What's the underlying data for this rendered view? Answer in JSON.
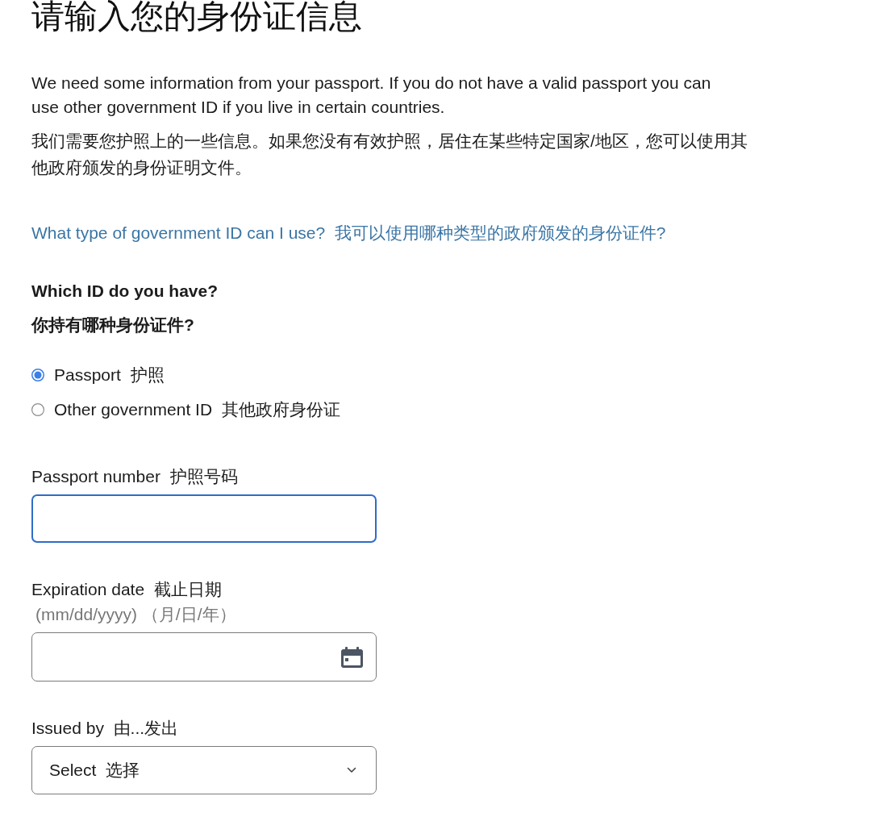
{
  "page": {
    "title": "请输入您的身份证信息"
  },
  "intro": {
    "english": "We need some information from your passport. If you do not have a valid passport you can use other government ID if you live in certain countries.",
    "chinese": "我们需要您护照上的一些信息。如果您没有有效护照，居住在某些特定国家/地区，您可以使用其他政府颁发的身份证明文件。"
  },
  "help_link": "What type of government ID can I use?  我可以使用哪种类型的政府颁发的身份证件?",
  "id_question": {
    "english": "Which ID do you have?",
    "chinese": "你持有哪种身份证件?",
    "options": [
      {
        "label": "Passport  护照",
        "selected": true
      },
      {
        "label": "Other government ID  其他政府身份证",
        "selected": false
      }
    ]
  },
  "fields": [
    {
      "kind": "text",
      "label": "Passport number  护照号码",
      "focused": true
    },
    {
      "kind": "date",
      "label": "Expiration date  截止日期",
      "hint": "(mm/dd/yyyy) （月/日/年）",
      "focused": false
    },
    {
      "kind": "select",
      "label": "Issued by  由...发出",
      "value": "Select  选择",
      "focused": false
    }
  ]
}
